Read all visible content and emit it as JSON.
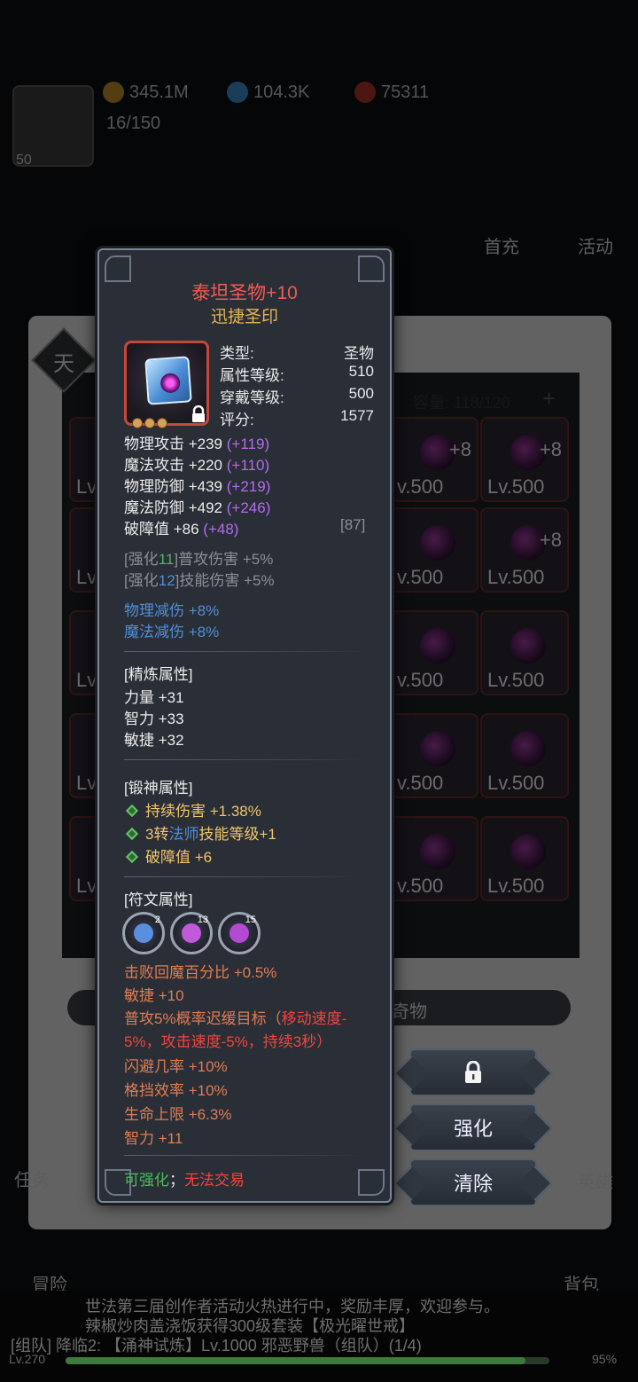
{
  "background": {
    "player_level": "50",
    "gold": "345.1M",
    "diamonds": "104.3K",
    "ruby": "75311",
    "energy": "16/150",
    "top_buttons": [
      "首充",
      "活动"
    ],
    "capacity": "容量: 118/120",
    "tian": "天",
    "slot_levels": [
      "Lv.",
      "v.500",
      "Lv.500"
    ],
    "slot_plus": "+8",
    "tab_label": "奇物",
    "bottom_nav": [
      "任务",
      "英雄",
      "冒险",
      "背包"
    ],
    "chat_line_1": "世法第三届创作者活动火热进行中，奖励丰厚，欢迎参与。",
    "chat_line_2": "辣椒炒肉盖浇饭获得300级套装【极光曜世戒】",
    "chat_line_3": "[组队] 降临2: 【涌神试炼】Lv.1000 邪恶野兽（组队）(1/4)",
    "xp_level": "Lv.270",
    "xp_percent": "95%",
    "xp_fraction": 0.95
  },
  "actions": {
    "lock": "lock-icon",
    "enhance_label": "强化",
    "clear_label": "清除"
  },
  "tooltip": {
    "title": "泰坦圣物+10",
    "subtitle": "迅捷圣印",
    "info": [
      {
        "label": "类型:",
        "value": "圣物"
      },
      {
        "label": "属性等级:",
        "value": "510"
      },
      {
        "label": "穿戴等级:",
        "value": "500"
      },
      {
        "label": "评分:",
        "value": "1577"
      }
    ],
    "base_stats": [
      {
        "text": "物理攻击 +239",
        "bonus": "(+119)"
      },
      {
        "text": "魔法攻击 +220",
        "bonus": "(+110)"
      },
      {
        "text": "物理防御 +439",
        "bonus": "(+219)"
      },
      {
        "text": "魔法防御 +492",
        "bonus": "(+246)"
      },
      {
        "text": "破障值 +86",
        "bonus": "(+48)",
        "extra": "[87]"
      }
    ],
    "enhance": [
      {
        "prefix": "[强化",
        "num": "11",
        "suffix": "]普攻伤害 +5%"
      },
      {
        "prefix": "[强化",
        "num": "12",
        "suffix": "]技能伤害 +5%"
      }
    ],
    "reductions": [
      "物理减伤 +8%",
      "魔法减伤 +8%"
    ],
    "refine_header": "[精炼属性]",
    "refine": [
      "力量 +31",
      "智力 +33",
      "敏捷 +32"
    ],
    "forge_header": "[锻神属性]",
    "forge": [
      {
        "a": "持续伤害 +1.38%",
        "b": "",
        "c": ""
      },
      {
        "a": "3转",
        "b": "法师",
        "c": "技能等级+1"
      },
      {
        "a": "破障值 +6",
        "b": "",
        "c": ""
      }
    ],
    "rune_header": "[符文属性]",
    "runes": [
      {
        "count": "2",
        "color": "#5a8fe0"
      },
      {
        "count": "13",
        "color": "#c05ad8"
      },
      {
        "count": "15",
        "color": "#b24bd0"
      }
    ],
    "rune_stats": [
      "击败回魔百分比 +0.5%",
      "敏捷 +10",
      "普攻5%概率迟缓目标（",
      "移动速度-",
      "5%，攻击速度-5%，持续3秒）",
      "闪避几率 +10%",
      "格挡效率 +10%",
      "生命上限 +6.3%",
      "智力 +11"
    ],
    "footer_ok": "可强化",
    "footer_sep": "；",
    "footer_no": "无法交易"
  }
}
